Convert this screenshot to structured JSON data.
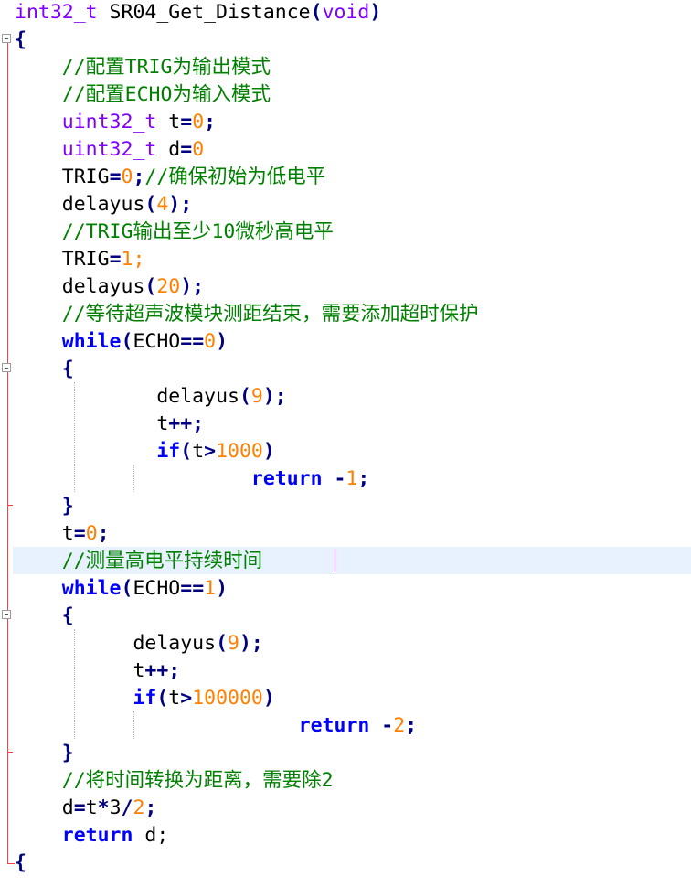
{
  "editor": {
    "language": "C",
    "current_line_index": 20,
    "colors": {
      "keyword": "#0000ff",
      "type": "#8000ff",
      "number": "#ff8000",
      "operator": "#000080",
      "comment": "#008000",
      "current_line": "#e8f2ff",
      "fold_margin_line": "#ff3b3b"
    },
    "lines": [
      {
        "tokens": [
          {
            "t": "int32_t",
            "c": "type"
          },
          {
            "t": " SR04_Get_Distance",
            "c": "plain"
          },
          {
            "t": "(",
            "c": "op"
          },
          {
            "t": "void",
            "c": "type"
          },
          {
            "t": ")",
            "c": "op"
          }
        ]
      },
      {
        "tokens": [
          {
            "t": "{",
            "c": "brace"
          }
        ]
      },
      {
        "tokens": [
          {
            "t": "    ",
            "c": "plain"
          },
          {
            "t": "//配置TRIG为输出模式",
            "c": "comment"
          }
        ]
      },
      {
        "tokens": [
          {
            "t": "    ",
            "c": "plain"
          },
          {
            "t": "//配置ECHO为输入模式",
            "c": "comment"
          }
        ]
      },
      {
        "tokens": [
          {
            "t": "    ",
            "c": "plain"
          },
          {
            "t": "uint32_t",
            "c": "type"
          },
          {
            "t": " t",
            "c": "plain"
          },
          {
            "t": "=",
            "c": "op"
          },
          {
            "t": "0",
            "c": "num"
          },
          {
            "t": ";",
            "c": "op"
          }
        ]
      },
      {
        "tokens": [
          {
            "t": "    ",
            "c": "plain"
          },
          {
            "t": "uint32_t",
            "c": "type"
          },
          {
            "t": " d",
            "c": "plain"
          },
          {
            "t": "=",
            "c": "op"
          },
          {
            "t": "0",
            "c": "num"
          }
        ]
      },
      {
        "tokens": [
          {
            "t": "    ",
            "c": "plain"
          },
          {
            "t": "TRIG",
            "c": "plain"
          },
          {
            "t": "=",
            "c": "op"
          },
          {
            "t": "0",
            "c": "num"
          },
          {
            "t": ";",
            "c": "op"
          },
          {
            "t": "//确保初始为低电平",
            "c": "comment"
          }
        ]
      },
      {
        "tokens": [
          {
            "t": "    ",
            "c": "plain"
          },
          {
            "t": "delayus",
            "c": "plain"
          },
          {
            "t": "(",
            "c": "op"
          },
          {
            "t": "4",
            "c": "num"
          },
          {
            "t": ");",
            "c": "op"
          }
        ]
      },
      {
        "tokens": [
          {
            "t": "    ",
            "c": "plain"
          },
          {
            "t": "//TRIG输出至少10微秒高电平",
            "c": "comment"
          }
        ]
      },
      {
        "tokens": [
          {
            "t": "    ",
            "c": "plain"
          },
          {
            "t": "TRIG",
            "c": "plain"
          },
          {
            "t": "=",
            "c": "op"
          },
          {
            "t": "1",
            "c": "num"
          },
          {
            "t": ";",
            "c": "num"
          }
        ]
      },
      {
        "tokens": [
          {
            "t": "    ",
            "c": "plain"
          },
          {
            "t": "delayus",
            "c": "plain"
          },
          {
            "t": "(",
            "c": "op"
          },
          {
            "t": "20",
            "c": "num"
          },
          {
            "t": ");",
            "c": "op"
          }
        ]
      },
      {
        "tokens": [
          {
            "t": "    ",
            "c": "plain"
          },
          {
            "t": "//等待超声波模块测距结束，需要添加超时保护",
            "c": "comment"
          }
        ]
      },
      {
        "tokens": [
          {
            "t": "    ",
            "c": "plain"
          },
          {
            "t": "while",
            "c": "kw"
          },
          {
            "t": "(",
            "c": "op"
          },
          {
            "t": "ECHO",
            "c": "plain"
          },
          {
            "t": "==",
            "c": "op"
          },
          {
            "t": "0",
            "c": "num"
          },
          {
            "t": ")",
            "c": "op"
          }
        ]
      },
      {
        "tokens": [
          {
            "t": "    ",
            "c": "plain"
          },
          {
            "t": "{",
            "c": "brace"
          }
        ]
      },
      {
        "tokens": [
          {
            "t": "            ",
            "c": "plain"
          },
          {
            "t": "delayus",
            "c": "plain"
          },
          {
            "t": "(",
            "c": "op"
          },
          {
            "t": "9",
            "c": "num"
          },
          {
            "t": ");",
            "c": "op"
          }
        ]
      },
      {
        "tokens": [
          {
            "t": "            ",
            "c": "plain"
          },
          {
            "t": "t",
            "c": "plain"
          },
          {
            "t": "++;",
            "c": "op"
          }
        ]
      },
      {
        "tokens": [
          {
            "t": "            ",
            "c": "plain"
          },
          {
            "t": "if",
            "c": "kw"
          },
          {
            "t": "(",
            "c": "op"
          },
          {
            "t": "t",
            "c": "plain"
          },
          {
            "t": ">",
            "c": "op"
          },
          {
            "t": "1000",
            "c": "num"
          },
          {
            "t": ")",
            "c": "op"
          }
        ]
      },
      {
        "tokens": [
          {
            "t": "                    ",
            "c": "plain"
          },
          {
            "t": "return",
            "c": "kw"
          },
          {
            "t": " ",
            "c": "plain"
          },
          {
            "t": "-",
            "c": "op"
          },
          {
            "t": "1",
            "c": "num"
          },
          {
            "t": ";",
            "c": "op"
          }
        ]
      },
      {
        "tokens": [
          {
            "t": "    ",
            "c": "plain"
          },
          {
            "t": "}",
            "c": "brace"
          }
        ]
      },
      {
        "tokens": [
          {
            "t": "    ",
            "c": "plain"
          },
          {
            "t": "t",
            "c": "plain"
          },
          {
            "t": "=",
            "c": "op"
          },
          {
            "t": "0",
            "c": "num"
          },
          {
            "t": ";",
            "c": "op"
          }
        ]
      },
      {
        "tokens": [
          {
            "t": "    ",
            "c": "plain"
          },
          {
            "t": "//测量高电平持续时间",
            "c": "comment"
          }
        ]
      },
      {
        "tokens": [
          {
            "t": "    ",
            "c": "plain"
          },
          {
            "t": "while",
            "c": "kw"
          },
          {
            "t": "(",
            "c": "op"
          },
          {
            "t": "ECHO",
            "c": "plain"
          },
          {
            "t": "==",
            "c": "op"
          },
          {
            "t": "1",
            "c": "num"
          },
          {
            "t": ")",
            "c": "op"
          }
        ]
      },
      {
        "tokens": [
          {
            "t": "    ",
            "c": "plain"
          },
          {
            "t": "{",
            "c": "brace"
          }
        ]
      },
      {
        "tokens": [
          {
            "t": "          ",
            "c": "plain"
          },
          {
            "t": "delayus",
            "c": "plain"
          },
          {
            "t": "(",
            "c": "op"
          },
          {
            "t": "9",
            "c": "num"
          },
          {
            "t": ");",
            "c": "op"
          }
        ]
      },
      {
        "tokens": [
          {
            "t": "          ",
            "c": "plain"
          },
          {
            "t": "t",
            "c": "plain"
          },
          {
            "t": "++;",
            "c": "op"
          }
        ]
      },
      {
        "tokens": [
          {
            "t": "          ",
            "c": "plain"
          },
          {
            "t": "if",
            "c": "kw"
          },
          {
            "t": "(",
            "c": "op"
          },
          {
            "t": "t",
            "c": "plain"
          },
          {
            "t": ">",
            "c": "op"
          },
          {
            "t": "100000",
            "c": "num"
          },
          {
            "t": ")",
            "c": "op"
          }
        ]
      },
      {
        "tokens": [
          {
            "t": "                        ",
            "c": "plain"
          },
          {
            "t": "return",
            "c": "kw"
          },
          {
            "t": " ",
            "c": "plain"
          },
          {
            "t": "-",
            "c": "op"
          },
          {
            "t": "2",
            "c": "num"
          },
          {
            "t": ";",
            "c": "op"
          }
        ]
      },
      {
        "tokens": [
          {
            "t": "    ",
            "c": "plain"
          },
          {
            "t": "}",
            "c": "brace"
          }
        ]
      },
      {
        "tokens": [
          {
            "t": "    ",
            "c": "plain"
          },
          {
            "t": "//将时间转换为距离，需要除2",
            "c": "comment"
          }
        ]
      },
      {
        "tokens": [
          {
            "t": "    ",
            "c": "plain"
          },
          {
            "t": "d",
            "c": "plain"
          },
          {
            "t": "=",
            "c": "op"
          },
          {
            "t": "t",
            "c": "plain"
          },
          {
            "t": "*",
            "c": "op"
          },
          {
            "t": "3",
            "c": "plain"
          },
          {
            "t": "/",
            "c": "op"
          },
          {
            "t": "2",
            "c": "num"
          },
          {
            "t": ";",
            "c": "op"
          }
        ]
      },
      {
        "tokens": [
          {
            "t": "    ",
            "c": "plain"
          },
          {
            "t": "return",
            "c": "kw"
          },
          {
            "t": " d;",
            "c": "plain"
          }
        ]
      },
      {
        "tokens": [
          {
            "t": "{",
            "c": "brace"
          }
        ]
      }
    ]
  }
}
